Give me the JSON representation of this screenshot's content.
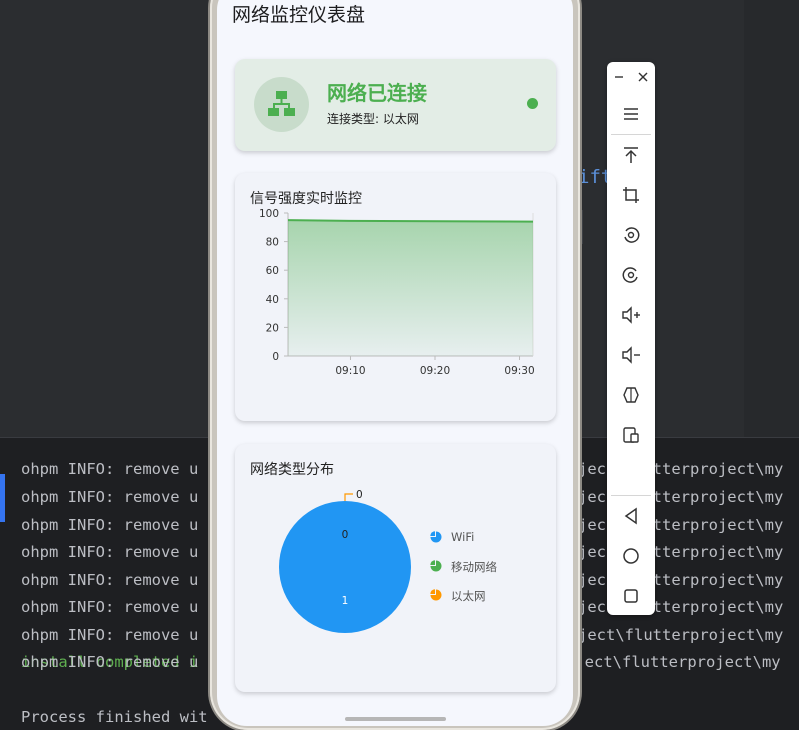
{
  "ide": {
    "editor_fragment": "ift",
    "console_lines": [
      {
        "left": "ohpm INFO: remove u",
        "right": "ject\\flutterproject\\my"
      },
      {
        "left": "ohpm INFO: remove u",
        "right": "ject\\flutterproject\\my"
      },
      {
        "left": "ohpm INFO: remove u",
        "right": "ject\\flutterproject\\my"
      },
      {
        "left": "ohpm INFO: remove u",
        "right": "ject\\flutterproject\\my"
      },
      {
        "left": "ohpm INFO: remove u",
        "right": "ject\\flutterproject\\my"
      },
      {
        "left": "ohpm INFO: remove u",
        "right": "ject\\flutterproject\\my"
      },
      {
        "left": "ohpm INFO: remove u",
        "right": "oject\\flutterproject\\my"
      }
    ],
    "partial_top_line": "ohpm INFO: remove u",
    "partial_top_right": "ject\\flutterproject\\my",
    "install_line": "install completed i",
    "process_line": "Process finished wit"
  },
  "app": {
    "title": "网络监控仪表盘",
    "status": {
      "title": "网络已连接",
      "subtitle": "连接类型: 以太网",
      "icon": "network-hierarchy-icon",
      "color": "#4caf50"
    },
    "signal_card_title": "信号强度实时监控",
    "distribution_card_title": "网络类型分布"
  },
  "chart_data": [
    {
      "type": "area",
      "title": "信号强度实时监控",
      "x_ticks": [
        "09:10",
        "09:20",
        "09:30"
      ],
      "y_ticks": [
        "0",
        "20",
        "40",
        "60",
        "80",
        "100"
      ],
      "ylim": [
        0,
        100
      ],
      "series": [
        {
          "values": [
            95,
            94.5,
            94.3,
            94.1,
            94.0
          ]
        }
      ],
      "grid": false,
      "color": "#4caf50"
    },
    {
      "type": "pie",
      "title": "网络类型分布",
      "labels": [
        "WiFi",
        "移动网络",
        "以太网"
      ],
      "values": [
        1,
        0,
        0
      ],
      "data_labels": [
        "1",
        "0",
        "0"
      ],
      "colors": [
        "#2196f3",
        "#4caf50",
        "#ff9800"
      ],
      "legend": "right"
    }
  ],
  "toolbar": {
    "buttons": [
      "menu-icon",
      "pin-top-icon",
      "crop-icon",
      "rotate-left-icon",
      "rotate-right-icon",
      "volume-up-icon",
      "volume-down-icon",
      "fold-device-icon",
      "screenshot-icon",
      "back-icon",
      "home-icon",
      "overview-icon"
    ]
  }
}
